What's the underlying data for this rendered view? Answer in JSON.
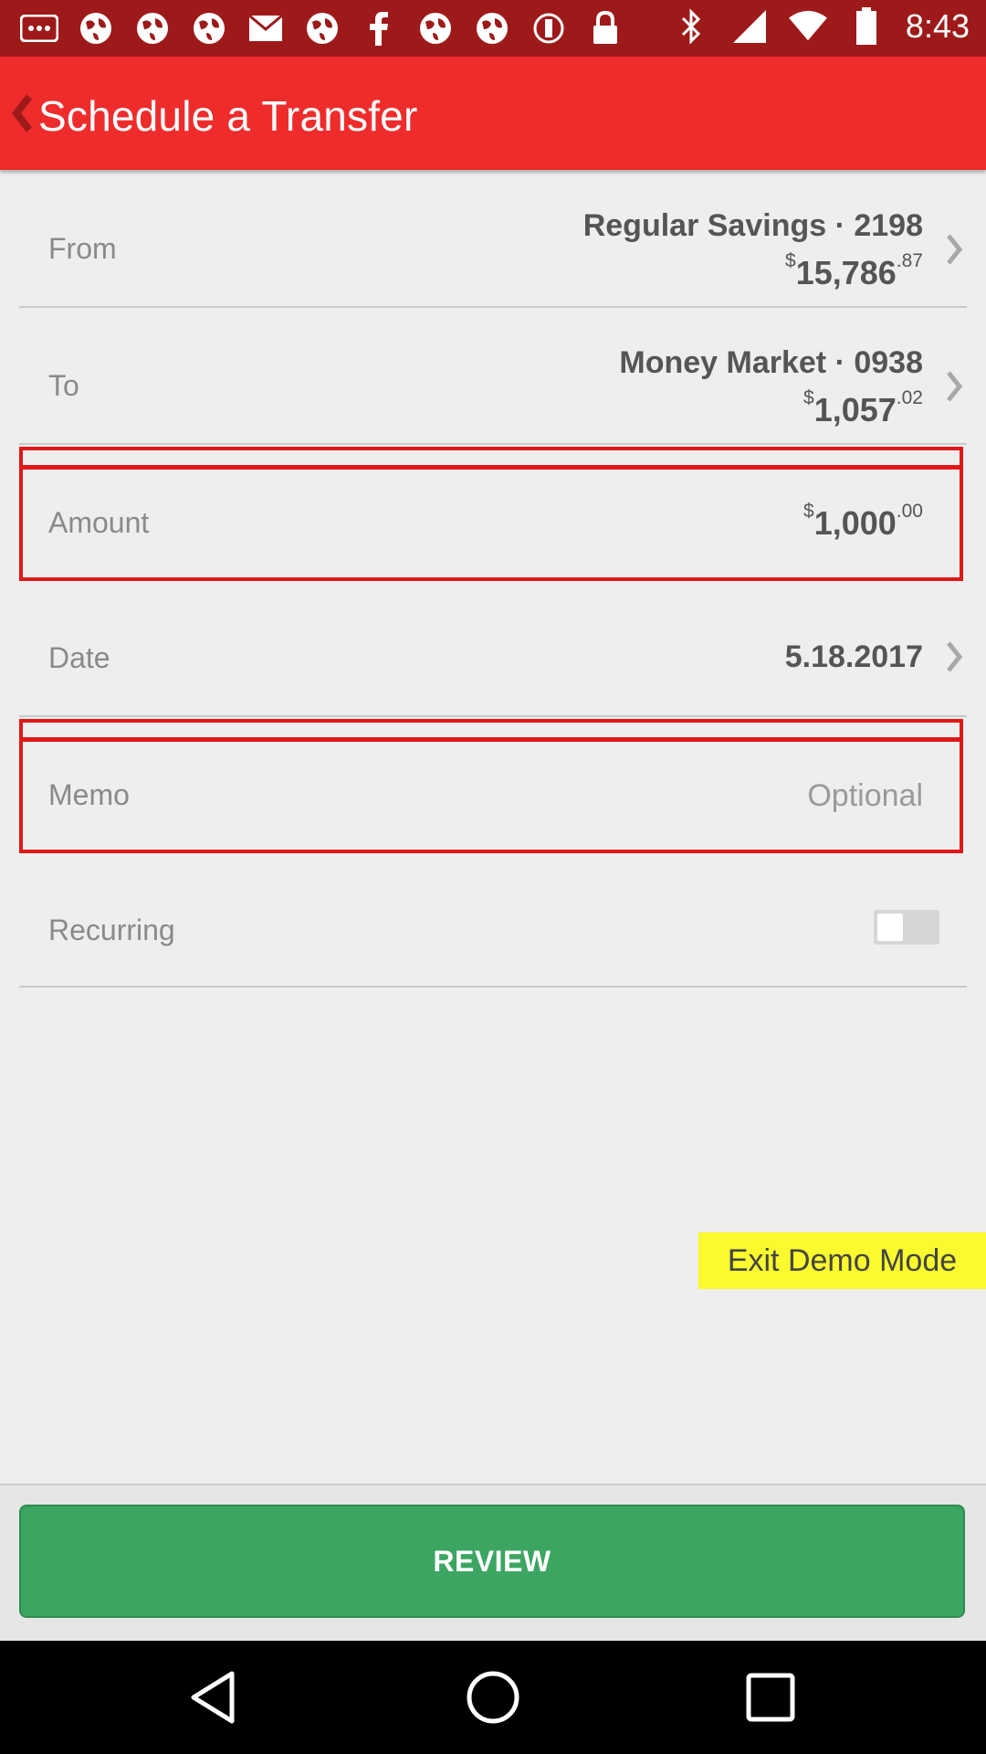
{
  "status_bar": {
    "time": "8:43",
    "left_icons": [
      "more-icon",
      "globe-icon",
      "globe-icon",
      "globe-icon",
      "mail-icon",
      "globe-icon",
      "facebook-icon",
      "globe-icon",
      "globe-icon",
      "circle-icon",
      "lock-icon"
    ],
    "right_icons": [
      "bluetooth-icon",
      "signal-icon",
      "wifi-icon",
      "battery-icon"
    ]
  },
  "header": {
    "title": "Schedule a Transfer"
  },
  "form": {
    "from": {
      "label": "From",
      "account": "Regular Savings · 2198",
      "dollar_sign": "$",
      "balance": "15,786",
      "cents": ".87"
    },
    "to": {
      "label": "To",
      "account": "Money Market · 0938",
      "dollar_sign": "$",
      "balance": "1,057",
      "cents": ".02"
    },
    "amount": {
      "label": "Amount",
      "dollar_sign": "$",
      "value": "1,000",
      "cents": ".00"
    },
    "date": {
      "label": "Date",
      "value": "5.18.2017"
    },
    "memo": {
      "label": "Memo",
      "placeholder": "Optional"
    },
    "recurring": {
      "label": "Recurring",
      "enabled": false
    }
  },
  "demo_button": "Exit Demo Mode",
  "review_button": "REVIEW",
  "colors": {
    "header": "#ee2c2c",
    "status_bar": "#9e1a1a",
    "review": "#3da562",
    "highlight": "#e01818",
    "demo": "#fafa2e"
  }
}
